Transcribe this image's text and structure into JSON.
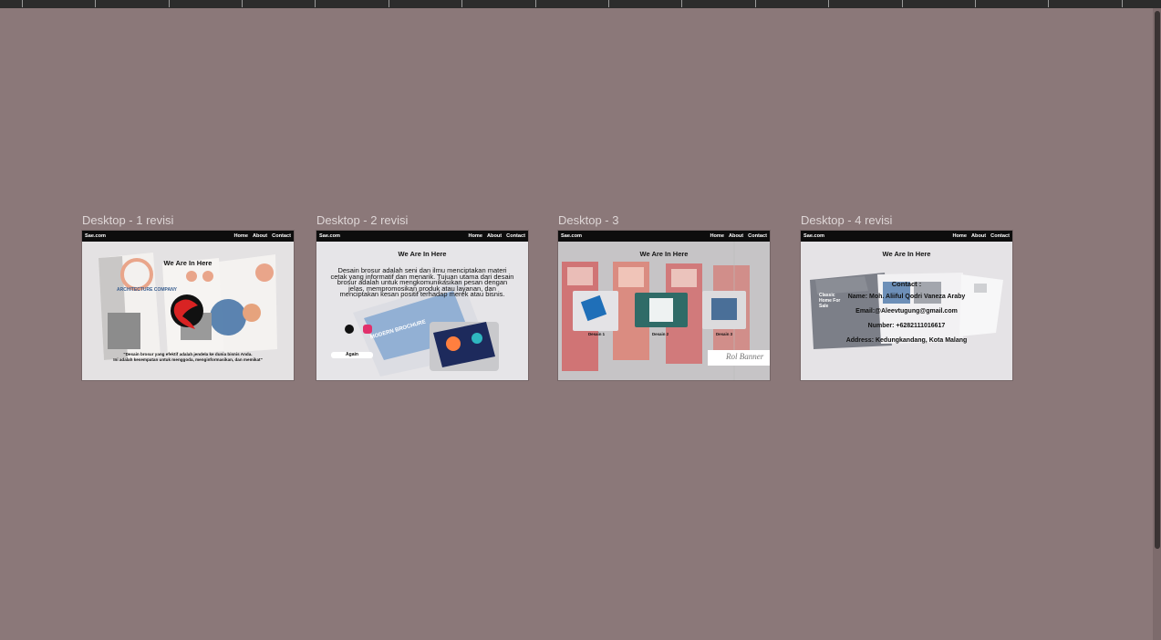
{
  "canvas": {
    "background": "#8b7879",
    "frames": [
      {
        "label": "Desktop - 1 revisi",
        "nav": {
          "logo": "Sae.com",
          "links": [
            "Home",
            "About",
            "Contact"
          ]
        },
        "heading": "We Are In Here",
        "brochure_text": "ARCHITECTURE COMPANY",
        "caption": [
          "\"Desain brosur yang efektif adalah jendela ke dunia bisnis Anda.",
          "Ini adalah kesempatan untuk menggoda, menginformasikan, dan memikat\""
        ]
      },
      {
        "label": "Desktop - 2 revisi",
        "nav": {
          "logo": "Sae.com",
          "links": [
            "Home",
            "About",
            "Contact"
          ]
        },
        "heading": "We Are In Here",
        "paragraph": "Desain brosur adalah seni dan ilmu menciptakan materi cetak yang informatif dan menarik. Tujuan utama dari desain brosur adalah untuk mengkomunikasikan pesan dengan jelas, mempromosikan produk atau layanan, dan menciptakan kesan positif terhadap merek atau bisnis.",
        "brochure_text": "MODERN BROCHURE",
        "button": "Again"
      },
      {
        "label": "Desktop - 3",
        "nav": {
          "logo": "Sae.com",
          "links": [
            "Home",
            "About",
            "Contact"
          ]
        },
        "heading": "We Are In Here",
        "designs": [
          "Desain 1",
          "Desain 2",
          "Desain 3"
        ],
        "banner_text": "Rol Banner"
      },
      {
        "label": "Desktop - 4 revisi",
        "nav": {
          "logo": "Sae.com",
          "links": [
            "Home",
            "About",
            "Contact"
          ]
        },
        "heading": "We Are In Here",
        "brochure_text": "Classic Home For Sale",
        "contact": {
          "title": "Contact :",
          "name": "Name: Moh. Aliiful Qodri Vaneza Araby",
          "email": "Email:@Aleevtugung@gmail.com",
          "number": "Number: +6282111016617",
          "address": "Address: Kedungkandang, Kota Malang"
        }
      }
    ]
  }
}
